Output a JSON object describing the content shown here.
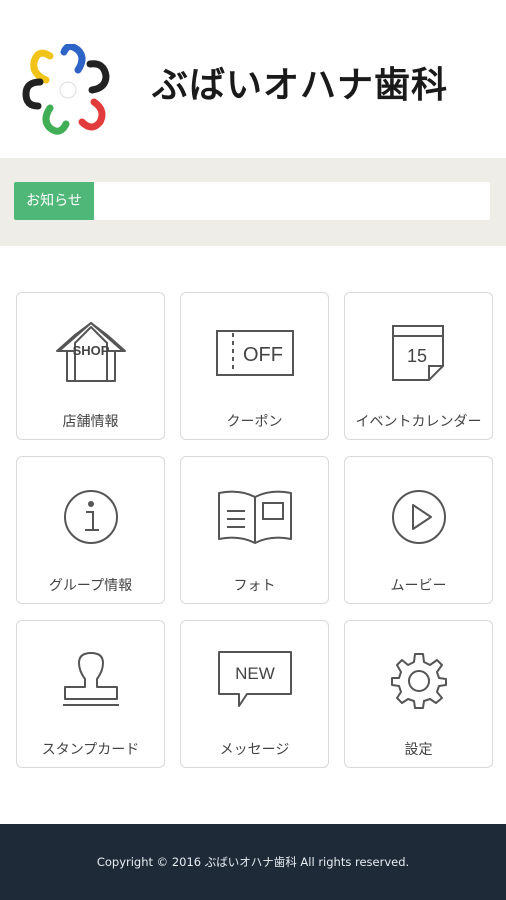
{
  "header": {
    "clinic_name": "ぶばいオハナ歯科"
  },
  "notice": {
    "label": "お知らせ",
    "text": ""
  },
  "menu": {
    "items": [
      {
        "label": "店舗情報",
        "icon": "shop-icon",
        "icon_text": "SHOP"
      },
      {
        "label": "クーポン",
        "icon": "coupon-icon",
        "icon_text": "OFF"
      },
      {
        "label": "イベントカレンダー",
        "icon": "calendar-icon",
        "icon_text": "15"
      },
      {
        "label": "グループ情報",
        "icon": "info-icon",
        "icon_text": "i"
      },
      {
        "label": "フォト",
        "icon": "photo-book-icon"
      },
      {
        "label": "ムービー",
        "icon": "play-icon"
      },
      {
        "label": "スタンプカード",
        "icon": "stamp-icon"
      },
      {
        "label": "メッセージ",
        "icon": "message-icon",
        "icon_text": "NEW"
      },
      {
        "label": "設定",
        "icon": "gear-icon"
      }
    ]
  },
  "footer": {
    "copyright": "Copyright © 2016 ぶばいオハナ歯科 All rights reserved."
  },
  "colors": {
    "notice_label_bg": "#4fb778",
    "notice_band_bg": "#efede8",
    "footer_bg": "#1e2a37",
    "tile_border": "#d9d9d9"
  }
}
